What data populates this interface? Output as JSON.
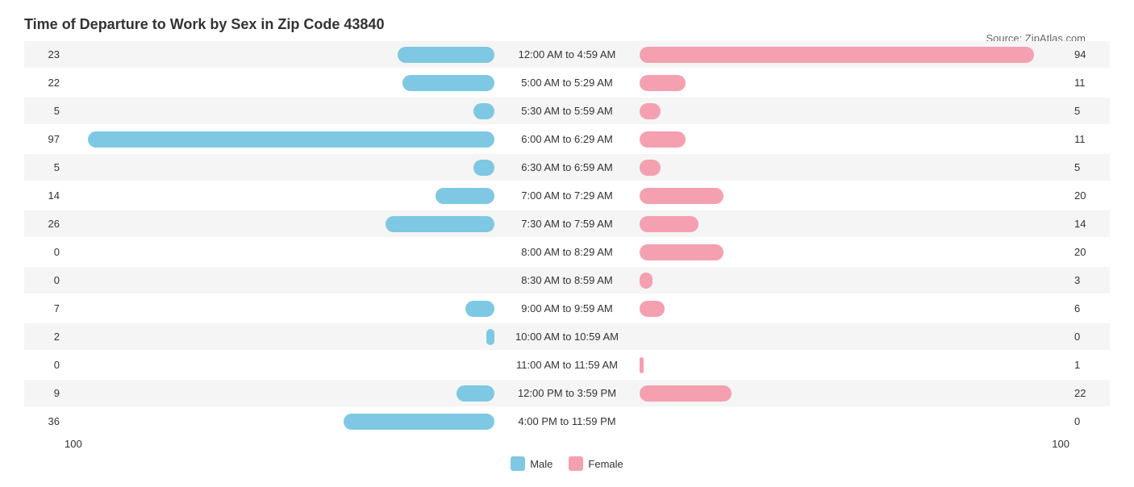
{
  "title": "Time of Departure to Work by Sex in Zip Code 43840",
  "source": "Source: ZipAtlas.com",
  "axis_min": "100",
  "axis_max": "100",
  "legend": {
    "male_label": "Male",
    "female_label": "Female",
    "male_color": "#7ec8e3",
    "female_color": "#f4a0b0"
  },
  "rows": [
    {
      "label": "12:00 AM to 4:59 AM",
      "male": 23,
      "female": 94
    },
    {
      "label": "5:00 AM to 5:29 AM",
      "male": 22,
      "female": 11
    },
    {
      "label": "5:30 AM to 5:59 AM",
      "male": 5,
      "female": 5
    },
    {
      "label": "6:00 AM to 6:29 AM",
      "male": 97,
      "female": 11
    },
    {
      "label": "6:30 AM to 6:59 AM",
      "male": 5,
      "female": 5
    },
    {
      "label": "7:00 AM to 7:29 AM",
      "male": 14,
      "female": 20
    },
    {
      "label": "7:30 AM to 7:59 AM",
      "male": 26,
      "female": 14
    },
    {
      "label": "8:00 AM to 8:29 AM",
      "male": 0,
      "female": 20
    },
    {
      "label": "8:30 AM to 8:59 AM",
      "male": 0,
      "female": 3
    },
    {
      "label": "9:00 AM to 9:59 AM",
      "male": 7,
      "female": 6
    },
    {
      "label": "10:00 AM to 10:59 AM",
      "male": 2,
      "female": 0
    },
    {
      "label": "11:00 AM to 11:59 AM",
      "male": 0,
      "female": 1
    },
    {
      "label": "12:00 PM to 3:59 PM",
      "male": 9,
      "female": 22
    },
    {
      "label": "4:00 PM to 11:59 PM",
      "male": 36,
      "female": 0
    }
  ],
  "max_value": 100
}
